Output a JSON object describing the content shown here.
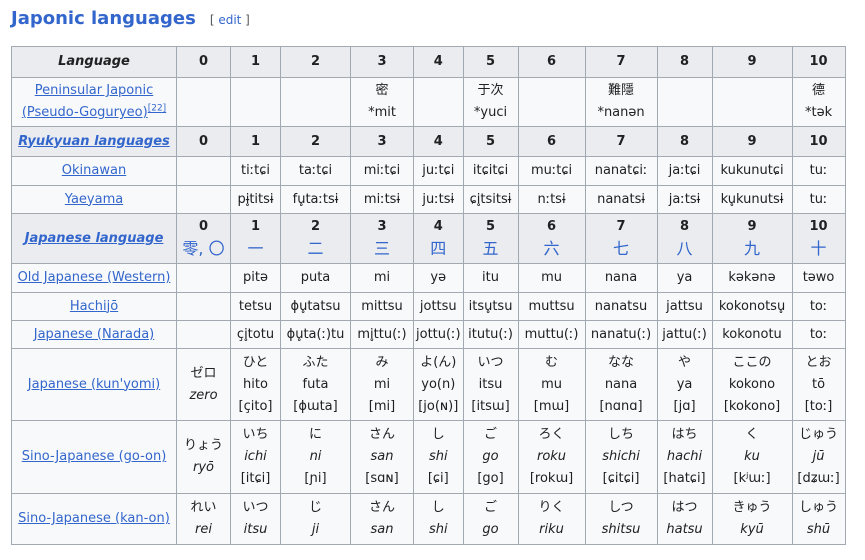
{
  "heading": {
    "title": "Japonic languages",
    "edit_open": "[ ",
    "edit_label": "edit",
    "edit_close": " ]"
  },
  "header": {
    "language": "Language",
    "nums": [
      "0",
      "1",
      "2",
      "3",
      "4",
      "5",
      "6",
      "7",
      "8",
      "9",
      "10"
    ]
  },
  "peninsular": {
    "label_1": "Peninsular Japonic",
    "label_2": "(Pseudo-Goguryeo)",
    "ref": "[22]",
    "c3_a": "密",
    "c3_b": "*mit",
    "c5_a": "于次",
    "c5_b": "*yuci",
    "c7_a": "難隱",
    "c7_b": "*nanən",
    "c10_a": "德",
    "c10_b": "*tək"
  },
  "ryukyuan": {
    "label": "Ryukyuan languages",
    "nums": [
      "0",
      "1",
      "2",
      "3",
      "4",
      "5",
      "6",
      "7",
      "8",
      "9",
      "10"
    ]
  },
  "okinawan": {
    "label": "Okinawan",
    "cells": [
      "",
      "tiːtɕi",
      "taːtɕi",
      "miːtɕi",
      "juːtɕi",
      "itɕitɕi",
      "muːtɕi",
      "nanatɕiː",
      "jaːtɕi",
      "kukunutɕi",
      "tuː"
    ]
  },
  "yaeyama": {
    "label": "Yaeyama",
    "cells": [
      "",
      "pɨ̥titsɨ",
      "fu̥taːtsɨ",
      "miːtsɨ",
      "juːtsɨ",
      "ɕi̥tsitsɨ",
      "nːtsɨ",
      "nanatsɨ",
      "jaːtsɨ",
      "ku̥kunutsɨ",
      "tuː"
    ]
  },
  "japanese_header": {
    "label": "Japanese language",
    "nums": [
      "0",
      "1",
      "2",
      "3",
      "4",
      "5",
      "6",
      "7",
      "8",
      "9",
      "10"
    ],
    "zero_kanji": "零, 〇",
    "kanji": [
      "一",
      "二",
      "三",
      "四",
      "五",
      "六",
      "七",
      "八",
      "九",
      "十"
    ]
  },
  "old_japanese": {
    "label": "Old Japanese (Western)",
    "cells": [
      "",
      "pitə",
      "puta",
      "mi",
      "yə",
      "itu",
      "mu",
      "nana",
      "ya",
      "kəkənə",
      "təwo"
    ]
  },
  "hachijo": {
    "label": "Hachijō",
    "cells": [
      "",
      "tetsu",
      "ɸu̥tatsu",
      "mittsu",
      "jottsu",
      "itsu̥tsu",
      "muttsu",
      "nanatsu",
      "jattsu",
      "kokonotsu̥",
      "toː"
    ]
  },
  "narada": {
    "label": "Japanese (Narada)",
    "cells": [
      "",
      "çi̥totu",
      "ɸu̥ta(ː)tu",
      "mi̥ttu(ː)",
      "jottu(ː)",
      "itutu(ː)",
      "muttu(ː)",
      "nanatu(ː)",
      "jattu(ː)",
      "kokonotu",
      "toː"
    ]
  },
  "kunyomi": {
    "label": "Japanese (kun'yomi)",
    "cells": [
      {
        "kana": "ゼロ",
        "rom": "zero",
        "ipa": ""
      },
      {
        "kana": "ひと",
        "rom": "hito",
        "ipa": "[çito]"
      },
      {
        "kana": "ふた",
        "rom": "futa",
        "ipa": "[ɸɯta]"
      },
      {
        "kana": "み",
        "rom": "mi",
        "ipa": "[mi]"
      },
      {
        "kana": "よ(ん)",
        "rom": "yo(n)",
        "ipa": "[jo(ɴ)]"
      },
      {
        "kana": "いつ",
        "rom": "itsu",
        "ipa": "[itsɯ]"
      },
      {
        "kana": "む",
        "rom": "mu",
        "ipa": "[mɯ]"
      },
      {
        "kana": "なな",
        "rom": "nana",
        "ipa": "[nɑnɑ]"
      },
      {
        "kana": "や",
        "rom": "ya",
        "ipa": "[jɑ]"
      },
      {
        "kana": "ここの",
        "rom": "kokono",
        "ipa": "[kokono]"
      },
      {
        "kana": "とお",
        "rom": "tō",
        "ipa": "[toː]"
      }
    ]
  },
  "goon": {
    "label": "Sino-Japanese (go-on)",
    "cells": [
      {
        "kana": "りょう",
        "rom": "ryō",
        "ipa": ""
      },
      {
        "kana": "いち",
        "rom": "ichi",
        "ipa": "[itɕi]"
      },
      {
        "kana": "に",
        "rom": "ni",
        "ipa": "[ɲi]"
      },
      {
        "kana": "さん",
        "rom": "san",
        "ipa": "[sɑɴ]"
      },
      {
        "kana": "し",
        "rom": "shi",
        "ipa": "[ɕi]"
      },
      {
        "kana": "ご",
        "rom": "go",
        "ipa": "[go]"
      },
      {
        "kana": "ろく",
        "rom": "roku",
        "ipa": "[rokɯ]"
      },
      {
        "kana": "しち",
        "rom": "shichi",
        "ipa": "[ɕitɕi]"
      },
      {
        "kana": "はち",
        "rom": "hachi",
        "ipa": "[hatɕi]"
      },
      {
        "kana": "く",
        "rom": "ku",
        "ipa": "[kʲɯː]"
      },
      {
        "kana": "じゅう",
        "rom": "jū",
        "ipa": "[dʑɯː]"
      }
    ]
  },
  "kanon": {
    "label": "Sino-Japanese (kan-on)",
    "cells": [
      {
        "kana": "れい",
        "rom": "rei"
      },
      {
        "kana": "いつ",
        "rom": "itsu"
      },
      {
        "kana": "じ",
        "rom": "ji"
      },
      {
        "kana": "さん",
        "rom": "san"
      },
      {
        "kana": "し",
        "rom": "shi"
      },
      {
        "kana": "ご",
        "rom": "go"
      },
      {
        "kana": "りく",
        "rom": "riku"
      },
      {
        "kana": "しつ",
        "rom": "shitsu"
      },
      {
        "kana": "はつ",
        "rom": "hatsu"
      },
      {
        "kana": "きゅう",
        "rom": "kyū"
      },
      {
        "kana": "しゅう",
        "rom": "shū"
      }
    ]
  }
}
